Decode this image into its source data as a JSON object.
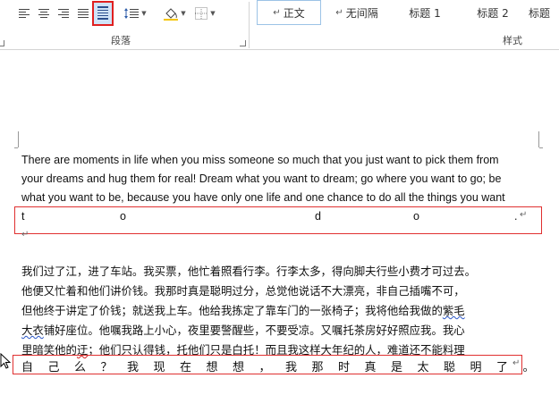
{
  "ribbon": {
    "paragraph_group_label": "段落",
    "styles_group_label": "样式",
    "buttons": {
      "align_left": "align-left-icon",
      "align_center": "align-center-icon",
      "align_right": "align-right-icon",
      "justify": "justify-icon",
      "distributed": "distributed-align-icon",
      "line_spacing": "line-spacing-icon",
      "shading": "shading-icon",
      "borders": "borders-icon"
    },
    "styles": [
      {
        "mark": "↵",
        "label": "正文",
        "selected": true
      },
      {
        "mark": "↵",
        "label": "无间隔",
        "selected": false
      },
      {
        "mark": "",
        "label": "标题 1",
        "selected": false
      },
      {
        "mark": "",
        "label": "标题 2",
        "selected": false
      },
      {
        "mark": "",
        "label": "标题",
        "selected": false
      }
    ],
    "accent_color": "#e02020"
  },
  "document": {
    "english_lines": [
      "There are moments in life when you miss someone so much that you just want to pick them from",
      "your dreams and hug them for real! Dream what you want to dream; go where you want to go; be",
      "what you want to be, because you have only one life and one chance to do all the things you want"
    ],
    "english_spread_chars": [
      "t",
      "o",
      "d",
      "o",
      "."
    ],
    "paragraph_mark": "↵",
    "chinese_lines": [
      "我们过了江，进了车站。我买票，他忙着照看行李。行李太多，得向脚夫行些小费才可过去。",
      "他便又忙着和他们讲价钱。我那时真是聪明过分，总觉他说话不大漂亮，非自己插嘴不可，",
      "但他终于讲定了价钱；就送我上车。他给我拣定了靠车门的一张椅子；我将他给我做的紫毛",
      "大衣铺好座位。他嘱我路上小心，夜里要警醒些，不要受凉。又嘱托茶房好好照应我。我心",
      "里暗笑他的迂；他们只认得钱，托他们只是白托！而且我这样大年纪的人，难道还不能料理"
    ],
    "chinese_line3_prefix": "但他终于讲定了价钱；就送我上车。他给我拣定了靠车门的一张椅子；我将他给我做的",
    "chinese_line3_flag": "紫毛",
    "chinese_line4_flag": "大衣",
    "chinese_line4_rest": "铺好座位。他嘱我路上小心，夜里要警醒些，不要受凉。又嘱托茶房好好照应我。我心",
    "chinese_line5_prefix": "里暗笑他的",
    "chinese_line5_flag": "迂",
    "chinese_line5_rest": "；他们只认得钱，托他们只是白托！而且我这样大年纪的人，难道还不能料理",
    "chinese_spread_line": "自己么？我现在想想，我那时真是太聪明了。"
  }
}
